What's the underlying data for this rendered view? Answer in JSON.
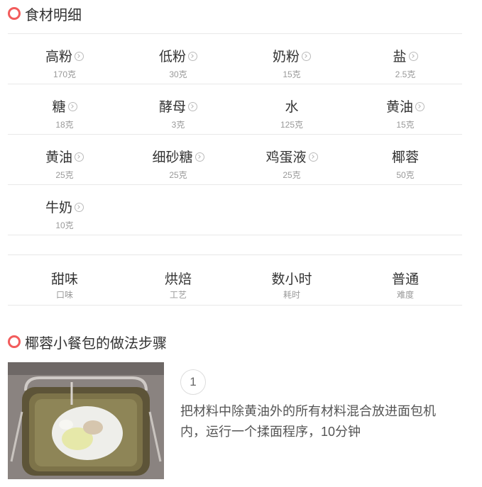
{
  "ingredients_title": "食材明细",
  "ingredients": [
    {
      "name": "高粉",
      "amount": "170克",
      "link": true
    },
    {
      "name": "低粉",
      "amount": "30克",
      "link": true
    },
    {
      "name": "奶粉",
      "amount": "15克",
      "link": true
    },
    {
      "name": "盐",
      "amount": "2.5克",
      "link": true
    },
    {
      "name": "糖",
      "amount": "18克",
      "link": true
    },
    {
      "name": "酵母",
      "amount": "3克",
      "link": true
    },
    {
      "name": "水",
      "amount": "125克",
      "link": false
    },
    {
      "name": "黄油",
      "amount": "15克",
      "link": true
    },
    {
      "name": "黄油",
      "amount": "25克",
      "link": true
    },
    {
      "name": "细砂糖",
      "amount": "25克",
      "link": true
    },
    {
      "name": "鸡蛋液",
      "amount": "25克",
      "link": true
    },
    {
      "name": "椰蓉",
      "amount": "50克",
      "link": false
    },
    {
      "name": "牛奶",
      "amount": "10克",
      "link": true
    }
  ],
  "attributes": [
    {
      "value": "甜味",
      "label": "口味"
    },
    {
      "value": "烘焙",
      "label": "工艺"
    },
    {
      "value": "数小时",
      "label": "耗时"
    },
    {
      "value": "普通",
      "label": "难度"
    }
  ],
  "steps_title": "椰蓉小餐包的做法步骤",
  "steps": [
    {
      "number": "1",
      "text": "把材料中除黄油外的所有材料混合放进面包机内，运行一个揉面程序，10分钟"
    }
  ],
  "colors": {
    "accent": "#f25c5c",
    "divider": "#e8e8e8"
  }
}
